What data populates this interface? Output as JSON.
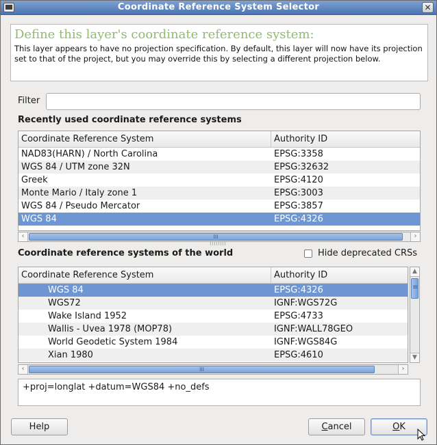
{
  "window": {
    "title": "Coordinate Reference System Selector",
    "close_glyph": "✕"
  },
  "info": {
    "heading": "Define this layer's coordinate reference system:",
    "description": "This layer appears to have no projection specification. By default, this layer will now have its projection set to that of the project, but you may override this by selecting a different projection below."
  },
  "filter": {
    "label": "Filter",
    "value": "",
    "placeholder": ""
  },
  "recent": {
    "title": "Recently used coordinate reference systems",
    "columns": [
      "Coordinate Reference System",
      "Authority ID"
    ],
    "rows": [
      {
        "name": "NAD83(HARN) / North Carolina",
        "id": "EPSG:3358",
        "selected": false
      },
      {
        "name": "WGS 84 / UTM zone 32N",
        "id": "EPSG:32632",
        "selected": false
      },
      {
        "name": "Greek",
        "id": "EPSG:4120",
        "selected": false
      },
      {
        "name": "Monte Mario / Italy zone 1",
        "id": "EPSG:3003",
        "selected": false
      },
      {
        "name": "WGS 84 / Pseudo Mercator",
        "id": "EPSG:3857",
        "selected": false
      },
      {
        "name": "WGS 84",
        "id": "EPSG:4326",
        "selected": true
      }
    ],
    "hscroll_grip": "III"
  },
  "world": {
    "title": "Coordinate reference systems of the world",
    "hide_deprecated_label": "Hide deprecated CRSs",
    "hide_deprecated_checked": false,
    "columns": [
      "Coordinate Reference System",
      "Authority ID"
    ],
    "rows": [
      {
        "name": "WGS 84",
        "id": "EPSG:4326",
        "selected": true
      },
      {
        "name": "WGS72",
        "id": "IGNF:WGS72G",
        "selected": false
      },
      {
        "name": "Wake Island 1952",
        "id": "EPSG:4733",
        "selected": false
      },
      {
        "name": "Wallis - Uvea 1978 (MOP78)",
        "id": "IGNF:WALL78GEO",
        "selected": false
      },
      {
        "name": "World Geodetic System 1984",
        "id": "IGNF:WGS84G",
        "selected": false
      },
      {
        "name": "Xian 1980",
        "id": "EPSG:4610",
        "selected": false
      }
    ],
    "hscroll_grip": "III",
    "vscroll_grip": "≡"
  },
  "proj_string": "+proj=longlat +datum=WGS84 +no_defs",
  "buttons": {
    "help": "Help",
    "cancel_accel": "C",
    "cancel_rest": "ancel",
    "ok_accel": "O",
    "ok_rest": "K"
  },
  "colors": {
    "titlebar": "#4a74b3",
    "selection": "#6d96d3",
    "heading": "#8fbb6e",
    "dialog_bg": "#eeedec"
  },
  "icons": {
    "app": "window-icon",
    "close": "close-icon",
    "scroll_left": "arrow-left-icon",
    "scroll_right": "arrow-right-icon",
    "scroll_up": "arrow-up-icon",
    "scroll_down": "arrow-down-icon",
    "cursor": "mouse-pointer-icon"
  }
}
